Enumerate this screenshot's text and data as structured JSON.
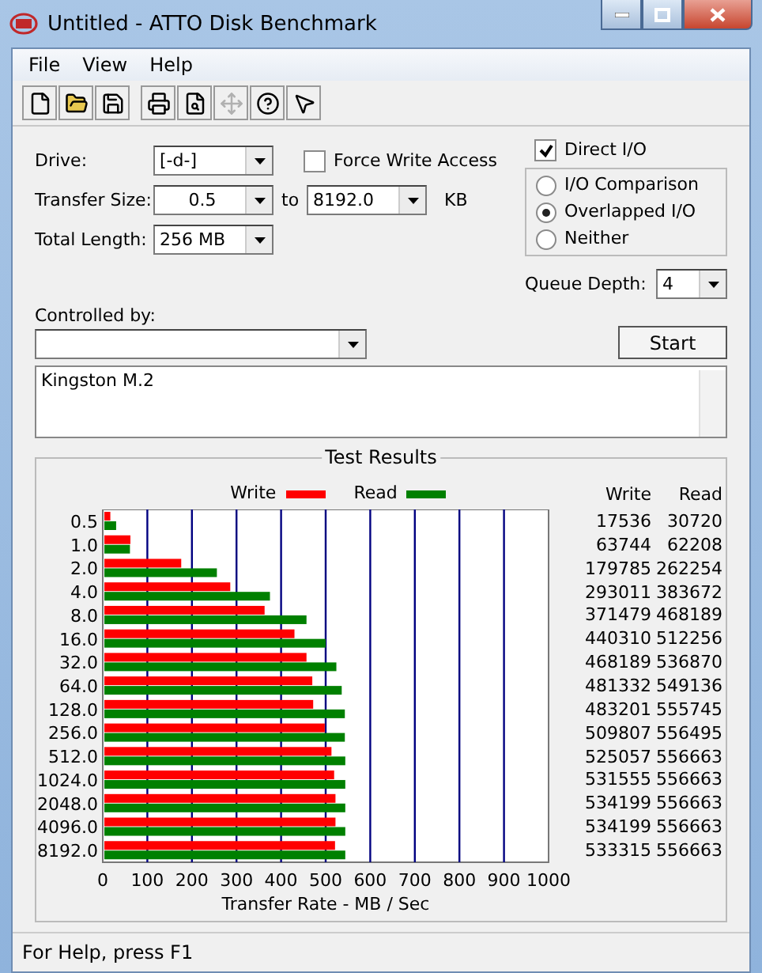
{
  "window": {
    "title": "Untitled - ATTO Disk Benchmark"
  },
  "menu": [
    "File",
    "View",
    "Help"
  ],
  "toolbar": [
    {
      "kind": "new",
      "disabled": false
    },
    {
      "kind": "open",
      "disabled": false
    },
    {
      "kind": "save",
      "disabled": false
    },
    {
      "kind": "print",
      "disabled": false
    },
    {
      "kind": "preview",
      "disabled": false
    },
    {
      "kind": "move",
      "disabled": true
    },
    {
      "kind": "help",
      "disabled": false
    },
    {
      "kind": "context-help",
      "disabled": false
    }
  ],
  "form": {
    "drive": {
      "label": "Drive:",
      "value": "[-d-]"
    },
    "force_write": {
      "label": "Force Write Access",
      "checked": false
    },
    "direct_io": {
      "label": "Direct I/O",
      "checked": true
    },
    "io_modes": [
      {
        "label": "I/O Comparison",
        "selected": false
      },
      {
        "label": "Overlapped I/O",
        "selected": true
      },
      {
        "label": "Neither",
        "selected": false
      }
    ],
    "transfer_size": {
      "label": "Transfer Size:",
      "from": "0.5",
      "to_label": "to",
      "to": "8192.0",
      "unit": "KB"
    },
    "total_length": {
      "label": "Total Length:",
      "value": "256 MB"
    },
    "queue_depth": {
      "label": "Queue Depth:",
      "value": "4"
    },
    "controlled_by": {
      "label": "Controlled by:"
    },
    "start_button": "Start",
    "description": "Kingston M.2"
  },
  "results": {
    "title": "Test Results",
    "columns": [
      "Write",
      "Read"
    ],
    "rows": [
      [
        "17536",
        "30720"
      ],
      [
        "63744",
        "62208"
      ],
      [
        "179785",
        "262254"
      ],
      [
        "293011",
        "383672"
      ],
      [
        "371479",
        "468189"
      ],
      [
        "440310",
        "512256"
      ],
      [
        "468189",
        "536870"
      ],
      [
        "481332",
        "549136"
      ],
      [
        "483201",
        "555745"
      ],
      [
        "509807",
        "556495"
      ],
      [
        "525057",
        "556663"
      ],
      [
        "531555",
        "556663"
      ],
      [
        "534199",
        "556663"
      ],
      [
        "534199",
        "556663"
      ],
      [
        "533315",
        "556663"
      ]
    ],
    "chart_data": {
      "type": "bar",
      "orientation": "horizontal",
      "xlabel": "Transfer Rate - MB / Sec",
      "categories": [
        "0.5",
        "1.0",
        "2.0",
        "4.0",
        "8.0",
        "16.0",
        "32.0",
        "64.0",
        "128.0",
        "256.0",
        "512.0",
        "1024.0",
        "2048.0",
        "4096.0",
        "8192.0"
      ],
      "series": [
        {
          "name": "Write",
          "color": "#ff0000",
          "values": [
            17,
            62,
            176,
            286,
            363,
            430,
            457,
            470,
            472,
            498,
            513,
            519,
            522,
            522,
            521
          ]
        },
        {
          "name": "Read",
          "color": "#008000",
          "values": [
            30,
            61,
            256,
            375,
            457,
            500,
            524,
            536,
            543,
            543,
            544,
            544,
            544,
            544,
            544
          ]
        }
      ],
      "grid": true,
      "xlim": [
        0,
        1000
      ],
      "xticks": [
        0,
        100,
        200,
        300,
        400,
        500,
        600,
        700,
        800,
        900,
        1000
      ]
    }
  },
  "status_bar": "For Help, press F1"
}
